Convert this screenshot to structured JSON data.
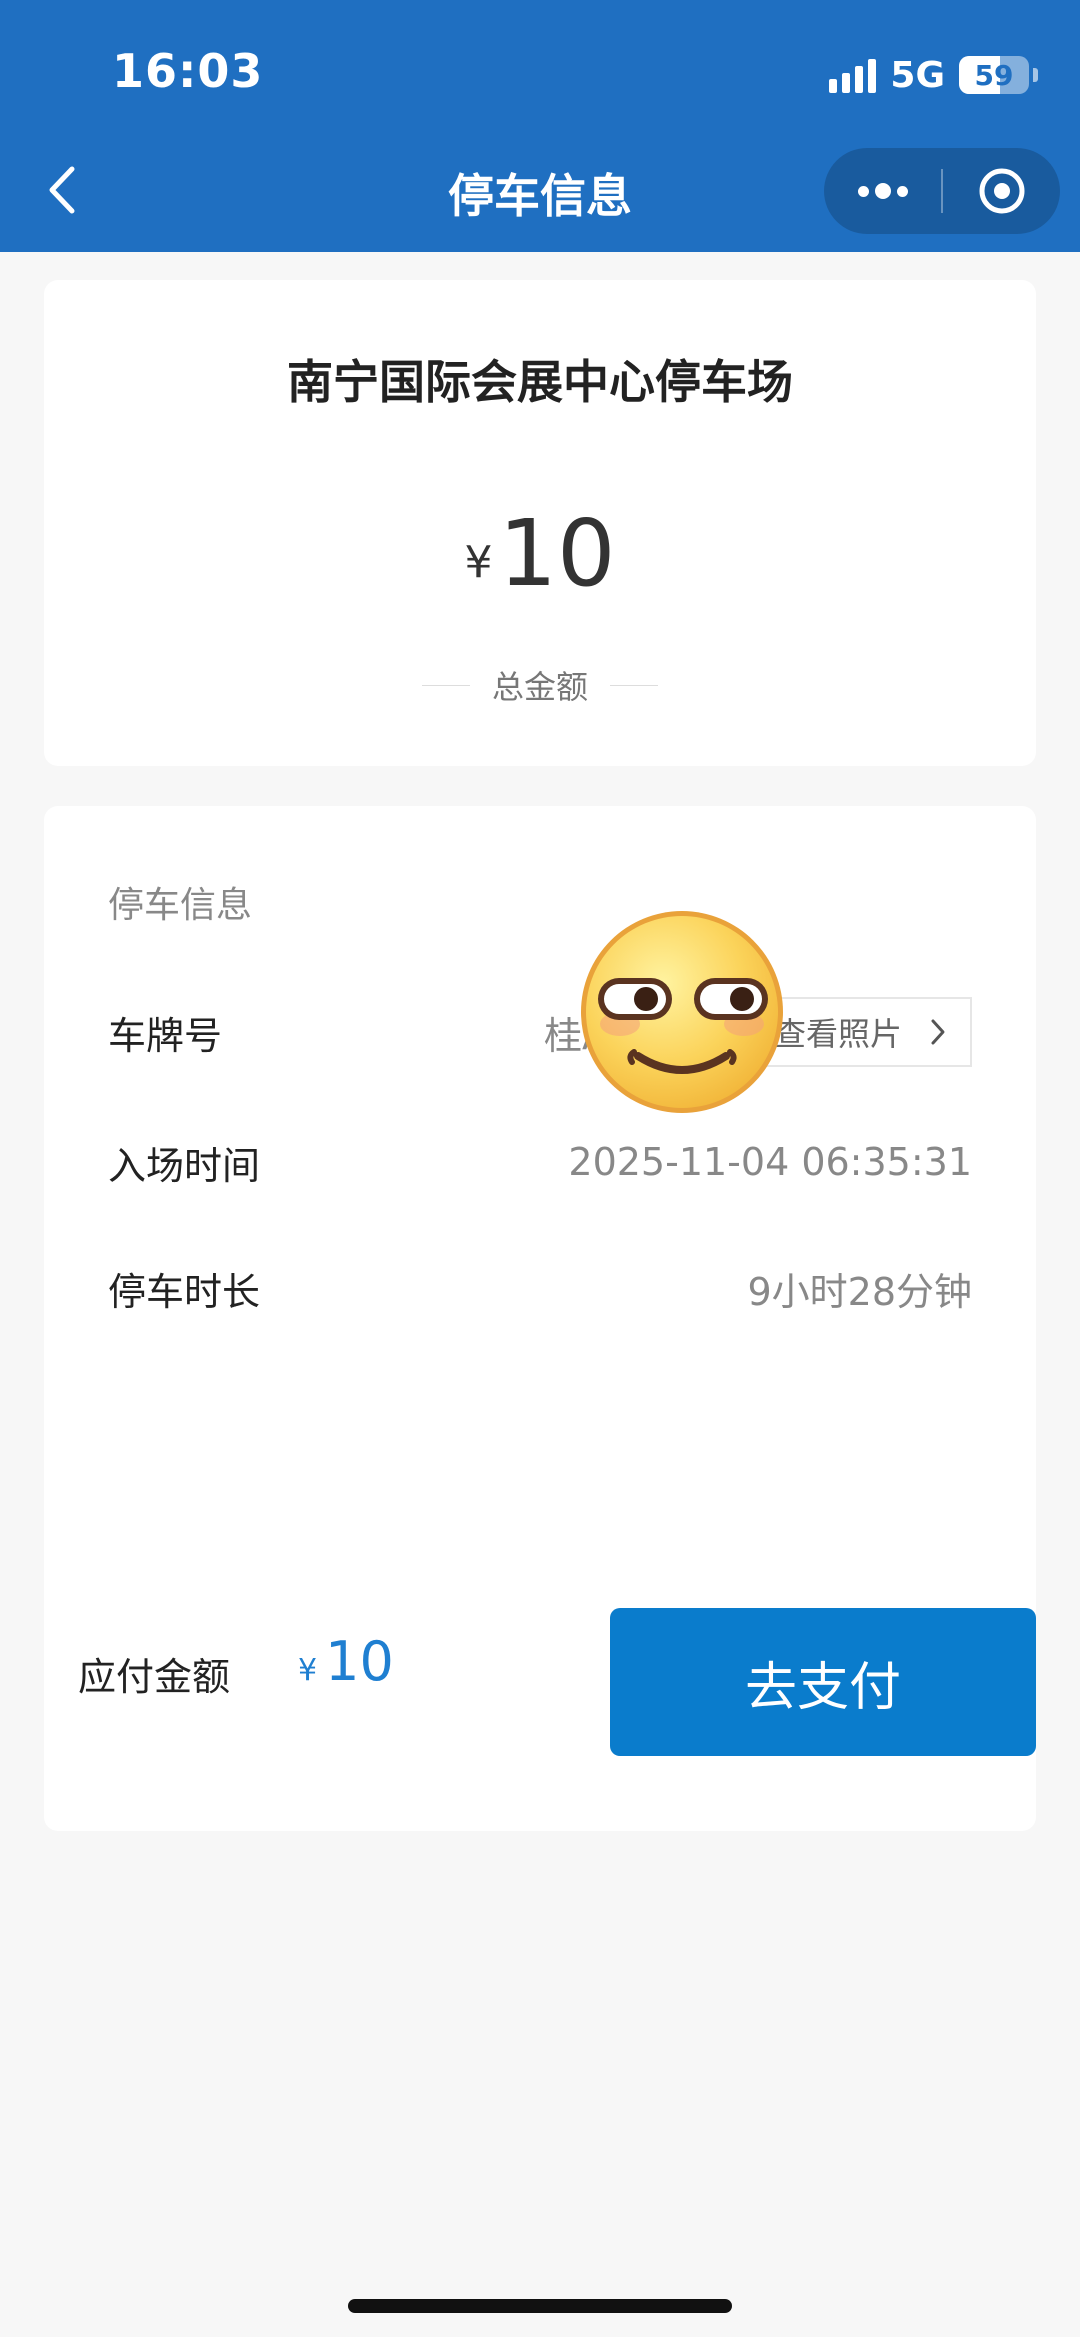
{
  "status_bar": {
    "time": "16:03",
    "network": "5G",
    "battery": "59",
    "battery_level": 0.59
  },
  "nav": {
    "title": "停车信息",
    "back_icon": "chevron-left-icon",
    "more_icon": "more-dots-icon",
    "close_icon": "target-circle-icon"
  },
  "summary": {
    "lot_name": "南宁国际会展中心停车场",
    "currency": "¥",
    "amount": "10",
    "amount_label": "总金额"
  },
  "details": {
    "section_title": "停车信息",
    "plate_label": "车牌号",
    "plate_value": "桂A",
    "photo_button": "查看照片",
    "entry_label": "入场时间",
    "entry_value": "2025-11-04 06:35:31",
    "duration_label": "停车时长",
    "duration_value": "9小时28分钟"
  },
  "payment": {
    "label": "应付金额",
    "currency": "¥",
    "amount": "10",
    "button": "去支付"
  },
  "colors": {
    "header": "#1f6fc1",
    "pay_button": "#0a7ccc",
    "amount_accent": "#1f7fd1"
  }
}
